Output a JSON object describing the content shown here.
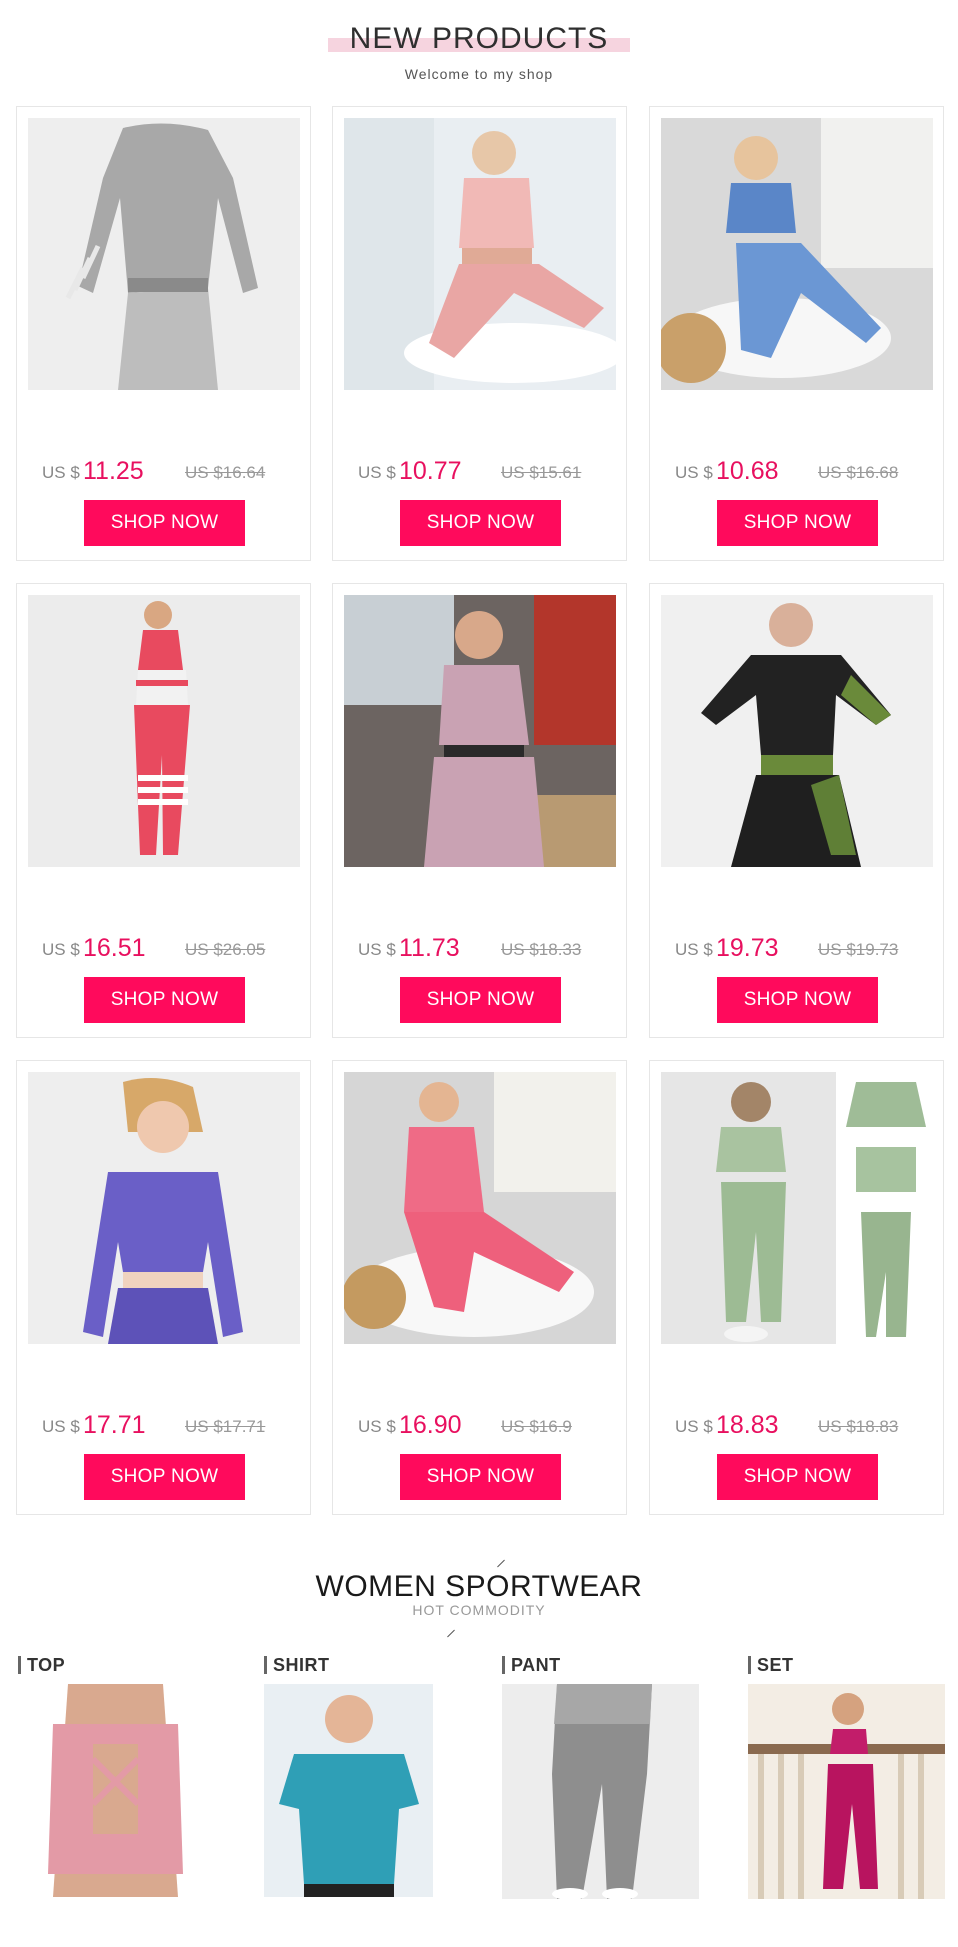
{
  "header": {
    "title": "NEW PRODUCTS",
    "subtitle": "Welcome to my shop"
  },
  "products": [
    {
      "currency": "US $",
      "price": "11.25",
      "old_price": "US $16.64",
      "button": "SHOP NOW",
      "theme": "gray-longsleeve"
    },
    {
      "currency": "US $",
      "price": "10.77",
      "old_price": "US $15.61",
      "button": "SHOP NOW",
      "theme": "pink-tank"
    },
    {
      "currency": "US $",
      "price": "10.68",
      "old_price": "US $16.68",
      "button": "SHOP NOW",
      "theme": "blue-tank"
    },
    {
      "currency": "US $",
      "price": "16.51",
      "old_price": "US $26.05",
      "button": "SHOP NOW",
      "theme": "red-striped"
    },
    {
      "currency": "US $",
      "price": "11.73",
      "old_price": "US $18.33",
      "button": "SHOP NOW",
      "theme": "mauve-gym"
    },
    {
      "currency": "US $",
      "price": "19.73",
      "old_price": "US $19.73",
      "button": "SHOP NOW",
      "theme": "black-green"
    },
    {
      "currency": "US $",
      "price": "17.71",
      "old_price": "US $17.71",
      "button": "SHOP NOW",
      "theme": "purple-longsleeve"
    },
    {
      "currency": "US $",
      "price": "16.90",
      "old_price": "US $16.9",
      "button": "SHOP NOW",
      "theme": "coral-set"
    },
    {
      "currency": "US $",
      "price": "18.83",
      "old_price": "US $18.83",
      "button": "SHOP NOW",
      "theme": "green-camo"
    }
  ],
  "sportwear": {
    "title": "WOMEN SPORTWEAR",
    "subtitle": "HOT  COMMODITY",
    "categories": [
      {
        "label": "TOP"
      },
      {
        "label": "SHIRT"
      },
      {
        "label": "PANT"
      },
      {
        "label": "SET"
      }
    ]
  },
  "colors": {
    "accent": "#ff0a5c",
    "price": "#e8105f",
    "title_highlight": "#f6d4df"
  }
}
